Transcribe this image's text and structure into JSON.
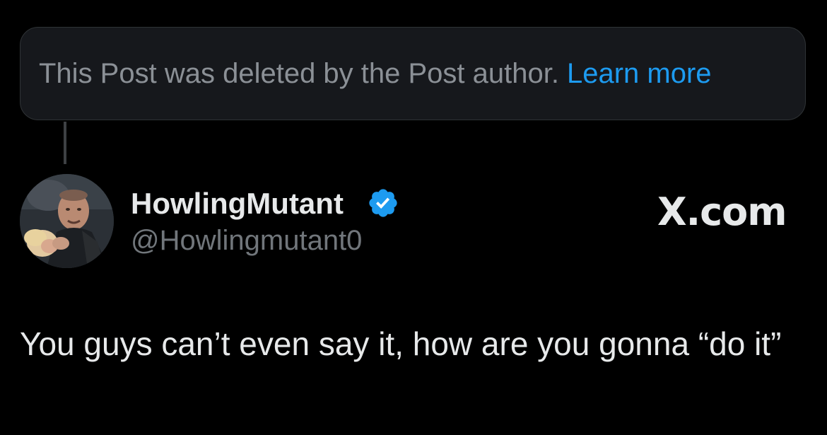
{
  "deleted_notice": {
    "text": "This Post was deleted by the Post author.",
    "link_label": "Learn more"
  },
  "author": {
    "display_name": "HowlingMutant",
    "handle": "@Howlingmutant0",
    "verified": true
  },
  "watermark": "X.com",
  "post": {
    "text": "You guys can’t even say it, how are you gonna “do it”"
  },
  "colors": {
    "background": "#000000",
    "link": "#1d9bf0",
    "verified_badge": "#1d9bf0",
    "primary_text": "#e7e9ea",
    "secondary_text": "#71767b"
  }
}
